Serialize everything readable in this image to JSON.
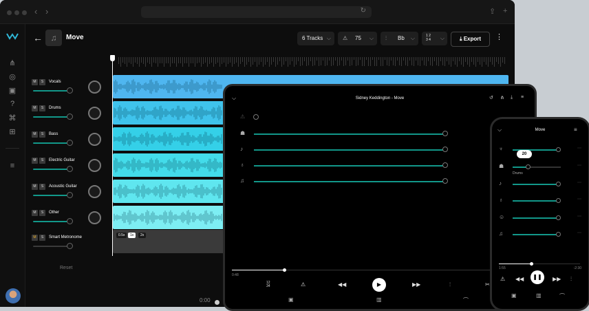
{
  "header": {
    "song_title": "Move",
    "tracks_dropdown": "6 Tracks",
    "tempo_value": "75",
    "key_value": "Bb",
    "time_signature": "1 2\n3 4",
    "export_label": "Export"
  },
  "tracks": [
    {
      "name": "Vocals",
      "mute": "M",
      "solo": "S"
    },
    {
      "name": "Drums",
      "mute": "M",
      "solo": "S"
    },
    {
      "name": "Bass",
      "mute": "M",
      "solo": "S"
    },
    {
      "name": "Electric Guitar",
      "mute": "M",
      "solo": "S"
    },
    {
      "name": "Acoustic Guitar",
      "mute": "M",
      "solo": "S"
    },
    {
      "name": "Other",
      "mute": "M",
      "solo": "S"
    },
    {
      "name": "Smart Metronome",
      "mute": "M",
      "solo": "S"
    }
  ],
  "reset_label": "Reset",
  "metronome_rates": [
    "0.5x",
    "1x",
    "2x"
  ],
  "bottom_time": "0:00",
  "lane_colors": [
    "#4fb6f0",
    "#3fc3ec",
    "#34d0e8",
    "#43dcea",
    "#5fe6ef",
    "#7deef3"
  ],
  "tablet": {
    "title": "Sidney Keddington - Move",
    "time_start": "0:48"
  },
  "phone": {
    "title": "Move",
    "tooltip_value": "20",
    "drums_label": "Drums",
    "time_start": "1:55",
    "time_end": "-2:30"
  }
}
